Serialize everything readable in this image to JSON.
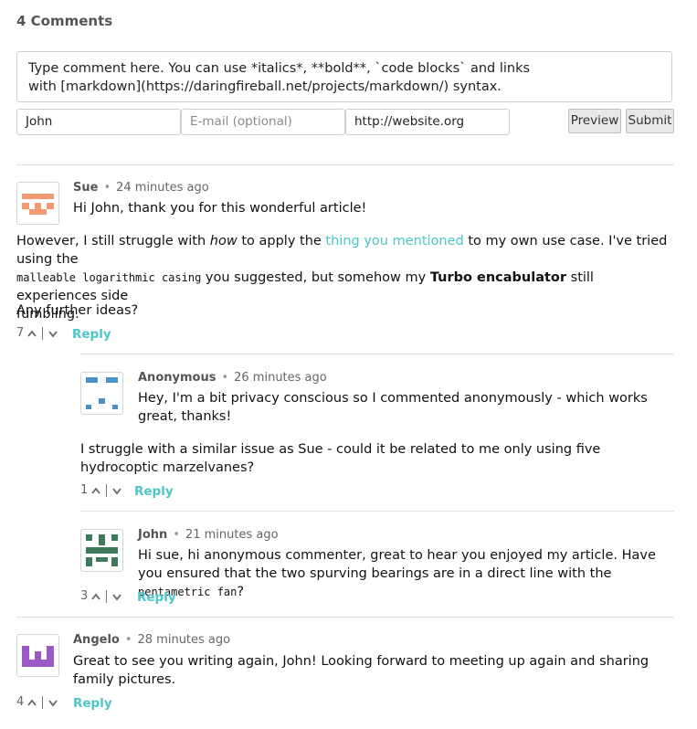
{
  "header": {
    "title": "4 Comments"
  },
  "form": {
    "comment_placeholder": "Type comment here. You can use *italics*, **bold**, `code blocks` and links\nwith [markdown](https://daringfireball.net/projects/markdown/) syntax.",
    "name_value": "John",
    "email_placeholder": "E-mail (optional)",
    "website_value": "http://website.org",
    "preview_label": "Preview",
    "submit_label": "Submit"
  },
  "comments": [
    {
      "author": "Sue",
      "time": "24 minutes ago",
      "text_first": "Hi John, thank you for this wonderful article!",
      "p2_a": "However, I still struggle with ",
      "p2_em": "how",
      "p2_b": " to apply the ",
      "p2_link": "thing you mentioned",
      "p2_c": " to my own use case. I've tried using the",
      "p2_code": "malleable logarithmic casing",
      "p2_d": " you suggested, but somehow my ",
      "p2_strong": "Turbo encabulator",
      "p2_e": " still experiences side",
      "p2_f": "fumbling.",
      "p3": "Any further ideas?",
      "votes": "7",
      "reply_label": "Reply",
      "avatar_color": "#f29a74"
    },
    {
      "author": "Anonymous",
      "time": "26 minutes ago",
      "text_first": "Hey, I'm a bit privacy conscious so I commented anonymously - which works great, thanks!",
      "p2": "I struggle with a similar issue as Sue - could it be related to me only using five hydrocoptic marzelvanes?",
      "votes": "1",
      "reply_label": "Reply",
      "avatar_color": "#4a90c8"
    },
    {
      "author": "John",
      "time": "21 minutes ago",
      "text_a": "Hi sue, hi anonymous commenter, great to hear you enjoyed my article. Have you ensured that the two spurving bearings are in a direct line with the ",
      "text_code": "pentametric fan",
      "text_b": "?",
      "votes": "3",
      "reply_label": "Reply",
      "avatar_color": "#3d7a5a"
    },
    {
      "author": "Angelo",
      "time": "28 minutes ago",
      "text_first": "Great to see you writing again, John! Looking forward to meeting up again and sharing family pictures.",
      "votes": "4",
      "reply_label": "Reply",
      "avatar_color": "#9b59c6"
    }
  ],
  "icons": {
    "upvote": "chevron-up-icon",
    "downvote": "chevron-down-icon"
  }
}
